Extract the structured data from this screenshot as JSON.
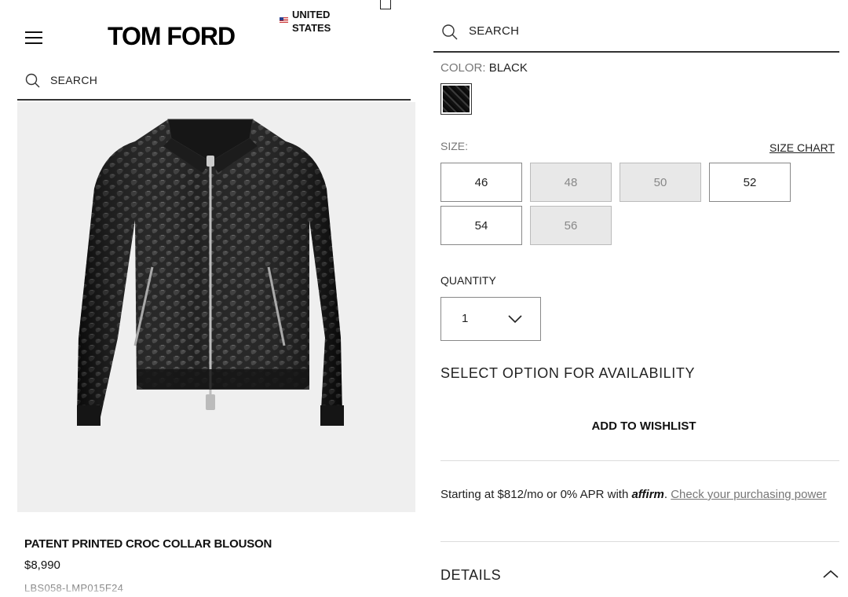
{
  "header": {
    "logo": "TOM FORD",
    "region_line1": "UNITED",
    "region_line2": "STATES"
  },
  "left_search": {
    "label": "SEARCH"
  },
  "product": {
    "name": "PATENT PRINTED CROC COLLAR BLOUSON",
    "price": "$8,990",
    "sku": "LBS058-LMP015F24"
  },
  "right_search": {
    "label": "SEARCH"
  },
  "color": {
    "key": "COLOR:",
    "value": "BLACK"
  },
  "size": {
    "label": "SIZE:",
    "chart_link": "SIZE CHART",
    "options": [
      {
        "label": "46",
        "available": true
      },
      {
        "label": "48",
        "available": false
      },
      {
        "label": "50",
        "available": false
      },
      {
        "label": "52",
        "available": true
      },
      {
        "label": "54",
        "available": true
      },
      {
        "label": "56",
        "available": false
      }
    ]
  },
  "quantity": {
    "label": "QUANTITY",
    "value": "1"
  },
  "availability_text": "SELECT OPTION FOR AVAILABILITY",
  "wishlist_label": "ADD TO WISHLIST",
  "financing": {
    "prefix": "Starting at $812/mo or 0% APR with ",
    "brand": "affirm",
    "suffix": ". ",
    "link": "Check your purchasing power"
  },
  "details_label": "DETAILS",
  "icons": {
    "menu": "hamburger-icon",
    "search": "search-icon",
    "bag": "shopping-bag-icon",
    "flag": "us-flag-icon",
    "dropdown": "chevron-down-icon",
    "collapse": "chevron-up-icon"
  },
  "colors": {
    "accent": "#111111",
    "unavailable_bg": "#e8e8e8",
    "muted_text": "#777777"
  }
}
